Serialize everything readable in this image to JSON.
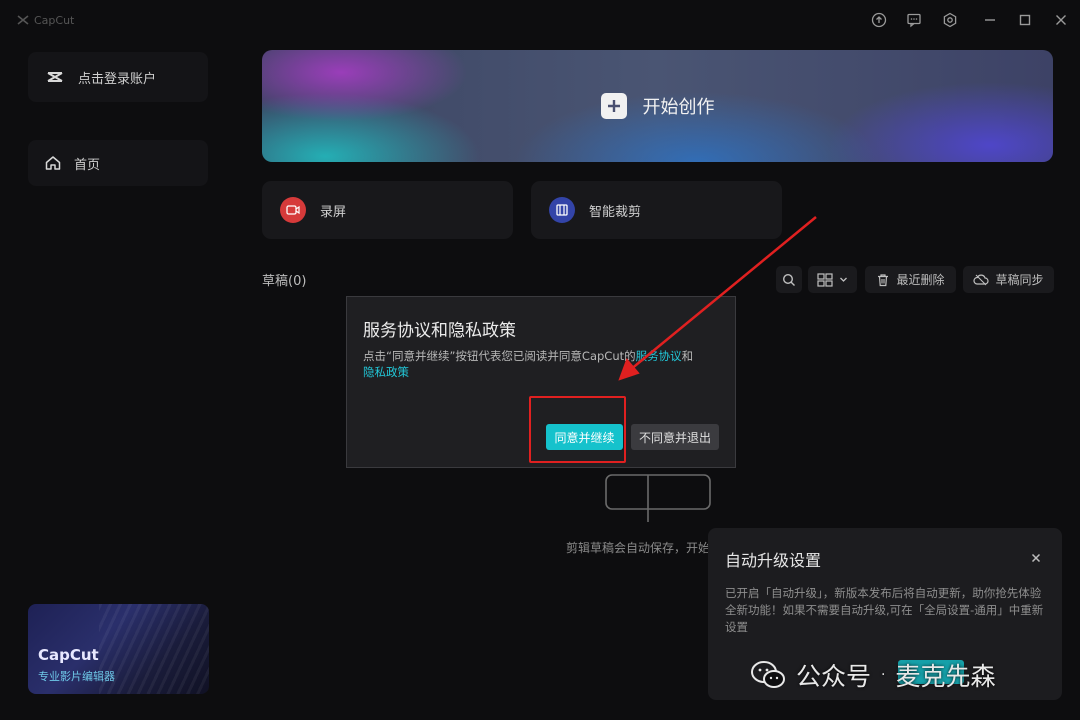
{
  "app": {
    "name": "CapCut"
  },
  "sidebar": {
    "login_label": "点击登录账户",
    "home_label": "首页",
    "promo": {
      "title": "CapCut",
      "subtitle": "专业影片编辑器"
    }
  },
  "main": {
    "hero_label": "开始创作",
    "tools": [
      {
        "label": "录屏",
        "icon": "record-screen-icon",
        "color": "#d63a3a"
      },
      {
        "label": "智能裁剪",
        "icon": "smart-crop-icon",
        "color": "#3344a8"
      }
    ],
    "drafts": {
      "title": "草稿(0)",
      "recent_delete": "最近删除",
      "sync": "草稿同步",
      "empty_text": "剪辑草稿会自动保存，开始"
    }
  },
  "dialog": {
    "title": "服务协议和隐私政策",
    "body_prefix": "点击“同意并继续”按钮代表您已阅读并同意CapCut的",
    "link_service": "服务协议",
    "body_and": "和",
    "link_privacy": "隐私政策",
    "agree_label": "同意并继续",
    "decline_label": "不同意并退出"
  },
  "toast": {
    "title": "自动升级设置",
    "body": "已开启「自动升级」，新版本发布后将自动更新，助你抢先体验全新功能！如果不需要自动升级,可在「全局设置-通用」中重新设置"
  },
  "watermark": {
    "label": "公众号",
    "dot": "·",
    "name": "麦克先森"
  },
  "colors": {
    "accent": "#15c2cc",
    "annotation": "#e02020",
    "background": "#0d0d0f"
  }
}
